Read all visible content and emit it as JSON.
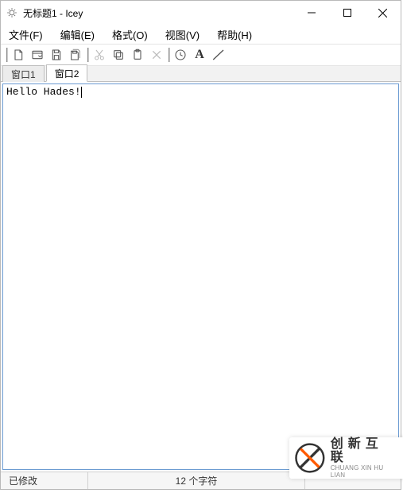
{
  "titlebar": {
    "title": "无标题1 - Icey"
  },
  "menubar": {
    "file": "文件(F)",
    "edit": "编辑(E)",
    "format": "格式(O)",
    "view": "视图(V)",
    "help": "帮助(H)"
  },
  "toolbar": {
    "icons": {
      "new": "new-file-icon",
      "new_window": "new-window-icon",
      "save": "save-icon",
      "save_all": "save-all-icon",
      "cut": "cut-icon",
      "copy": "copy-icon",
      "paste": "paste-icon",
      "delete": "delete-icon",
      "history": "history-icon",
      "font": "font-icon",
      "line": "line-icon"
    }
  },
  "tabs": {
    "items": [
      {
        "label": "窗口1",
        "active": false
      },
      {
        "label": "窗口2",
        "active": true
      }
    ]
  },
  "editor": {
    "content": "Hello Hades!"
  },
  "statusbar": {
    "modified": "已修改",
    "char_count": "12 个字符",
    "right": ""
  },
  "watermark": {
    "cn": "创新互联",
    "en": "CHUANG XIN HU LIAN"
  }
}
